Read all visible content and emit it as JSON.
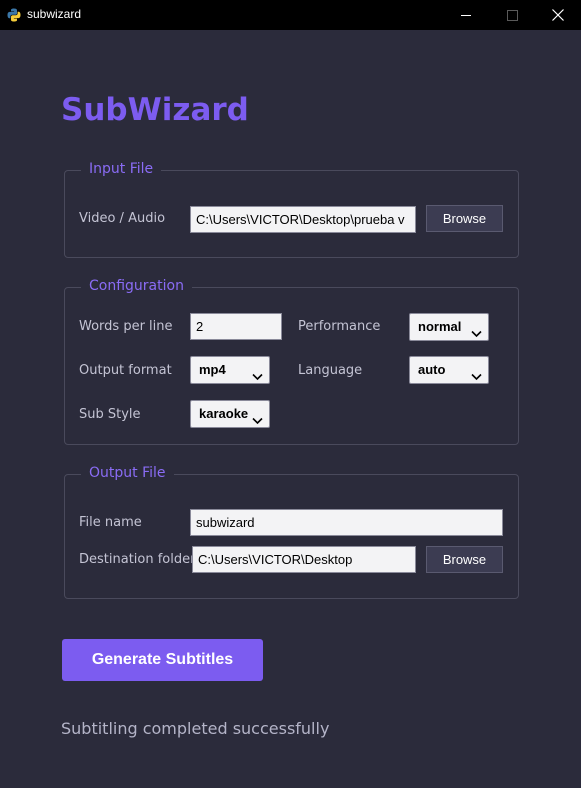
{
  "window": {
    "title": "subwizard",
    "app_icon": "python-icon",
    "controls": {
      "minimize_icon": "minimize-icon",
      "maximize_icon": "maximize-icon",
      "close_icon": "close-icon"
    }
  },
  "app": {
    "title": "SubWizard",
    "accent_color": "#7c5cf0",
    "background_color": "#2b2b3b"
  },
  "input_file": {
    "legend": "Input File",
    "video_label": "Video / Audio",
    "video_path": "C:\\Users\\VICTOR\\Desktop\\prueba v",
    "browse_label": "Browse"
  },
  "configuration": {
    "legend": "Configuration",
    "words_per_line_label": "Words per line",
    "words_per_line_value": "2",
    "performance_label": "Performance",
    "performance_value": "normal",
    "output_format_label": "Output format",
    "output_format_value": "mp4",
    "language_label": "Language",
    "language_value": "auto",
    "sub_style_label": "Sub Style",
    "sub_style_value": "karaoke"
  },
  "output_file": {
    "legend": "Output File",
    "file_name_label": "File name",
    "file_name_value": "subwizard",
    "destination_label": "Destination folder",
    "destination_value": "C:\\Users\\VICTOR\\Desktop",
    "browse_label": "Browse"
  },
  "actions": {
    "generate_label": "Generate Subtitles"
  },
  "status": {
    "message": "Subtitling completed successfully"
  }
}
